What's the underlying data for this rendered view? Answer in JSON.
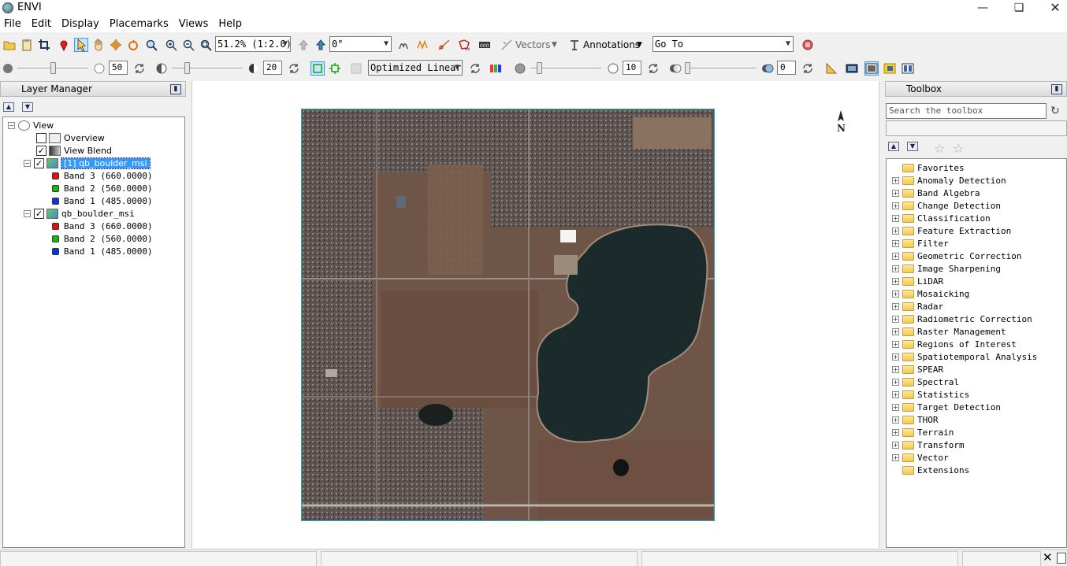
{
  "window": {
    "title": "ENVI"
  },
  "menu": [
    "File",
    "Edit",
    "Display",
    "Placemarks",
    "Views",
    "Help"
  ],
  "toolbar1": {
    "zoom_value": "51.2% (1:2.0)",
    "rotation_value": "0°",
    "vectors_label": "Vectors",
    "annotations_label": "Annotations",
    "goto_label": "Go To"
  },
  "toolbar2": {
    "brightness_value": "50",
    "contrast_value": "20",
    "stretch_value": "Optimized Linear",
    "sharpen_value": "10",
    "transparency_value": "0"
  },
  "layer_manager": {
    "title": "Layer Manager",
    "tree": {
      "root": "View",
      "overview": "Overview",
      "view_blend": "View Blend",
      "layer1": {
        "label": "[1] qb_boulder_msi",
        "bands": [
          "Band 3 (660.0000)",
          "Band 2 (560.0000)",
          "Band 1 (485.0000)"
        ]
      },
      "layer2": {
        "label": "qb_boulder_msi",
        "bands": [
          "Band 3 (660.0000)",
          "Band 2 (560.0000)",
          "Band 1 (485.0000)"
        ]
      }
    }
  },
  "display": {
    "north_label": "N"
  },
  "toolbox": {
    "title": "Toolbox",
    "search_placeholder": "Search the toolbox",
    "items": [
      "Favorites",
      "Anomaly Detection",
      "Band Algebra",
      "Change Detection",
      "Classification",
      "Feature Extraction",
      "Filter",
      "Geometric Correction",
      "Image Sharpening",
      "LiDAR",
      "Mosaicking",
      "Radar",
      "Radiometric Correction",
      "Raster Management",
      "Regions of Interest",
      "Spatiotemporal Analysis",
      "SPEAR",
      "Spectral",
      "Statistics",
      "Target Detection",
      "THOR",
      "Terrain",
      "Transform",
      "Vector",
      "Extensions"
    ]
  },
  "colors": {
    "selection": "#3399ff",
    "band_red": "#dd1111",
    "band_green": "#11bb11",
    "band_blue": "#1133dd",
    "water": "#1b2a2a"
  }
}
